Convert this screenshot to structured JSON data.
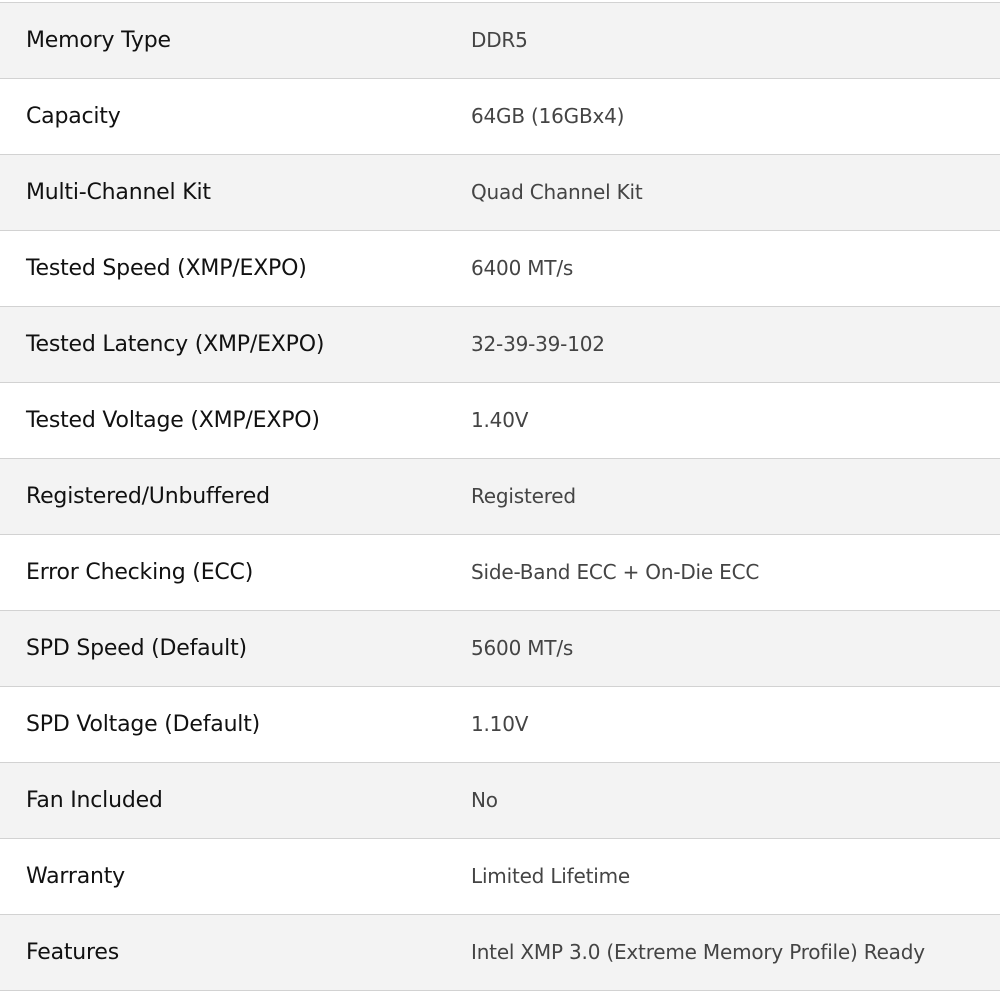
{
  "specs": [
    {
      "label": "Memory Type",
      "value": "DDR5"
    },
    {
      "label": "Capacity",
      "value": "64GB (16GBx4)"
    },
    {
      "label": "Multi-Channel Kit",
      "value": "Quad Channel Kit"
    },
    {
      "label": "Tested Speed (XMP/EXPO)",
      "value": "6400 MT/s"
    },
    {
      "label": "Tested Latency (XMP/EXPO)",
      "value": "32-39-39-102"
    },
    {
      "label": "Tested Voltage (XMP/EXPO)",
      "value": "1.40V"
    },
    {
      "label": "Registered/Unbuffered",
      "value": "Registered"
    },
    {
      "label": "Error Checking (ECC)",
      "value": "Side-Band ECC + On-Die ECC"
    },
    {
      "label": "SPD Speed (Default)",
      "value": "5600 MT/s"
    },
    {
      "label": "SPD Voltage (Default)",
      "value": "1.10V"
    },
    {
      "label": "Fan Included",
      "value": "No"
    },
    {
      "label": "Warranty",
      "value": "Limited Lifetime"
    },
    {
      "label": "Features",
      "value": "Intel XMP 3.0 (Extreme Memory Profile) Ready"
    }
  ]
}
